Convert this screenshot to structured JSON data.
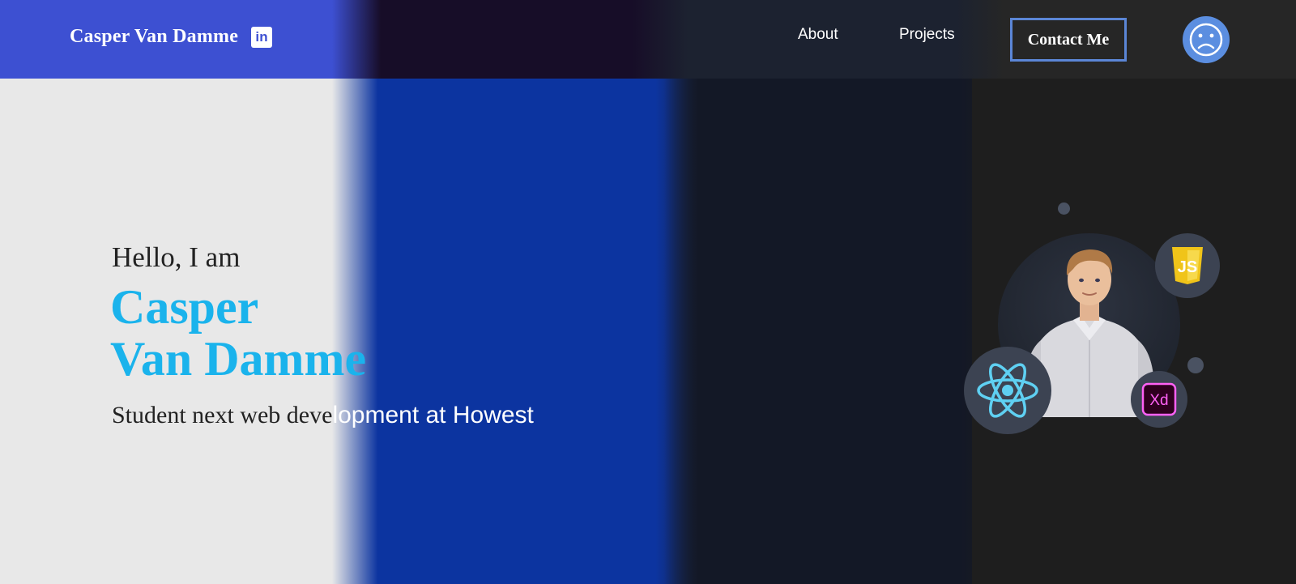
{
  "header": {
    "brand_name": "Casper Van Damme",
    "linkedin_icon": "linkedin-icon",
    "nav": {
      "about_label": "About",
      "projects_label": "Projects"
    },
    "contact_label": "Contact Me",
    "theme_toggle_icon": "sad-face-icon"
  },
  "hero": {
    "greeting": "Hello, I am",
    "name_line1": "Casper",
    "name_line2": "Van Damme",
    "subtitle_part1": "Student next web deve",
    "subtitle_part2": "lopment at Howest"
  },
  "illustration": {
    "icons": [
      "javascript-icon",
      "react-icon",
      "adobe-xd-icon",
      "avatar"
    ],
    "js_label": "JS",
    "xd_label": "Xd"
  },
  "colors": {
    "accent": "#1ab3ec",
    "header_blue": "#3d50d2",
    "panel_blue": "#0c34a0",
    "contact_border": "#5b86d6",
    "toggle": "#5b8ee0"
  }
}
